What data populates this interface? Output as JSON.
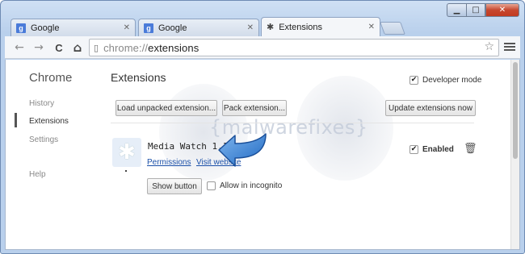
{
  "window": {
    "controls": {
      "minimize": "▁",
      "maximize": "□",
      "close": "✕"
    }
  },
  "tabs": [
    {
      "label": "Google",
      "icon": "google-favicon",
      "favicon_text": "g",
      "close": "✕"
    },
    {
      "label": "Google",
      "icon": "google-favicon",
      "favicon_text": "g",
      "close": "✕"
    },
    {
      "label": "Extensions",
      "icon": "puzzle-icon",
      "close": "✕",
      "active": true
    }
  ],
  "toolbar": {
    "back": "←",
    "forward": "→",
    "reload": "C",
    "home": "⌂",
    "url_scheme": "chrome://",
    "url_path": "extensions",
    "star": "☆"
  },
  "sidebar": {
    "title": "Chrome",
    "items": [
      {
        "label": "History"
      },
      {
        "label": "Extensions",
        "active": true
      },
      {
        "label": "Settings"
      },
      {
        "label": "Help"
      }
    ]
  },
  "main": {
    "title": "Extensions",
    "developer_mode_label": "Developer mode",
    "developer_mode_checked": true,
    "buttons": {
      "load_unpacked": "Load unpacked extension...",
      "pack": "Pack extension...",
      "update": "Update extensions now"
    }
  },
  "extension": {
    "name": "Media Watch  1.1",
    "permissions_link": "Permissions",
    "visit_link": "Visit website",
    "enabled_label": "Enabled",
    "enabled_checked": true,
    "show_button": "Show button",
    "incognito_label": "Allow in incognito",
    "incognito_checked": false
  },
  "watermark": "{malwarefixes}",
  "colors": {
    "frame": "#b9d0ec",
    "link": "#1a4fa8",
    "arrow": "#2f7fd6",
    "close_button": "#c6472f"
  }
}
